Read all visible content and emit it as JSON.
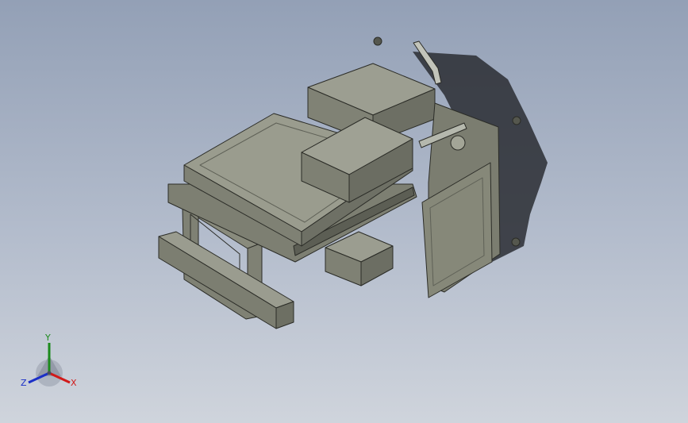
{
  "viewport": {
    "background_top": "#93a0b6",
    "background_bottom": "#cfd4dc"
  },
  "model": {
    "body_color": "#8f9183",
    "shadow_color": "#2a2d33",
    "edge_color": "#2b2c27"
  },
  "triad": {
    "x_label": "X",
    "y_label": "Y",
    "z_label": "Z",
    "x_color": "#d11a1a",
    "y_color": "#1c8a1c",
    "z_color": "#1b2fc7"
  }
}
